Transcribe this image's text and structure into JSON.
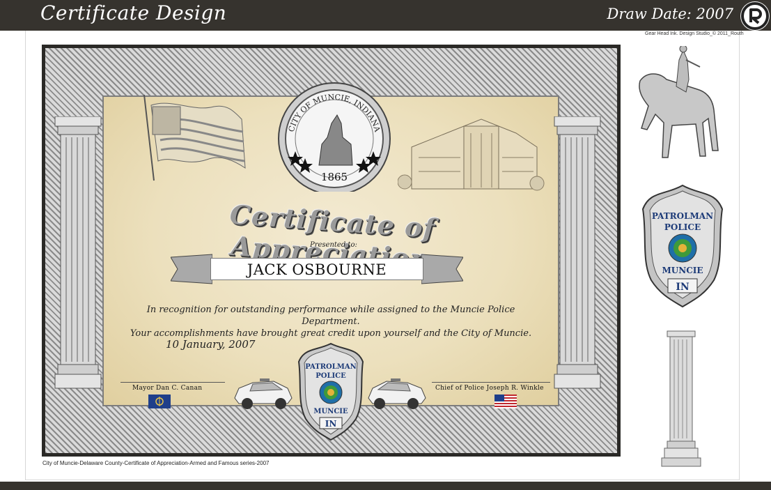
{
  "header": {
    "title": "Certificate Design",
    "draw_date": "Draw Date: 2007",
    "logo_icon": "rd-logo-icon"
  },
  "credit": "Gear Head Ink. Design Studio_© 2011_Routh",
  "caption": "City of Muncie-Delaware County-Certificate of Appreciation-Armed and Famous series-2007",
  "certificate": {
    "seal": {
      "arc_text": "CITY OF MUNCIE, INDIANA",
      "year": "1865"
    },
    "title": "Certificate of Appreciation",
    "presented_to": "Presented to:",
    "recipient": "JACK OSBOURNE",
    "recognition_line1": "In recognition for outstanding performance while assigned to the Muncie Police Department.",
    "recognition_line2": "Your accomplishments have brought great credit upon yourself and the City of Muncie.",
    "date": "10 January, 2007",
    "signatories": {
      "left": "Mayor Dan C. Canan",
      "right": "Chief of Police Joseph R. Winkle"
    },
    "badge": {
      "top": "PATROLMAN",
      "middle": "POLICE",
      "bottom": "MUNCIE",
      "state": "IN"
    }
  },
  "side_art": {
    "badge": {
      "top": "PATROLMAN",
      "middle": "POLICE",
      "bottom": "MUNCIE",
      "state": "IN"
    }
  },
  "colors": {
    "bar": "#36332e",
    "parchment": "#ece0bd",
    "frame": "#2a2926"
  }
}
